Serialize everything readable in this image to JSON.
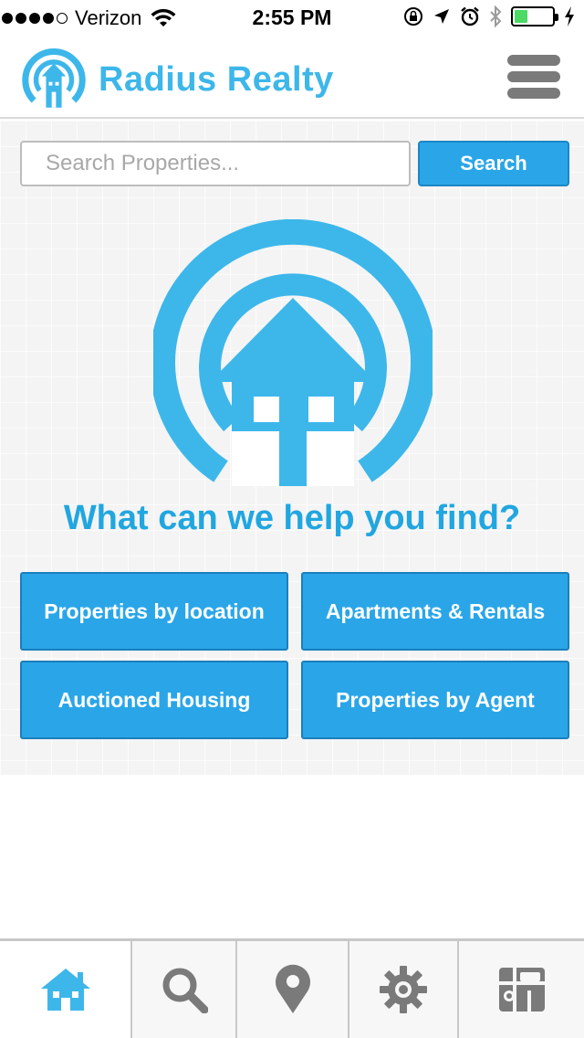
{
  "status_bar": {
    "carrier": "Verizon",
    "time": "2:55 PM",
    "signal_bars_filled": 4,
    "signal_bars_total": 5,
    "battery_level": 0.35,
    "icons": [
      "wifi-icon",
      "rotation-lock-icon",
      "location-arrow-icon",
      "alarm-icon",
      "bluetooth-icon",
      "battery-icon",
      "charging-icon"
    ]
  },
  "header": {
    "brand": "Radius Realty",
    "menu_icon": "hamburger-menu-icon"
  },
  "search": {
    "placeholder": "Search Properties...",
    "value": "",
    "button_label": "Search"
  },
  "hero": {
    "logo_icon": "radius-house-logo-icon",
    "tagline": "What can we help you find?"
  },
  "categories": [
    {
      "label": "Properties by location"
    },
    {
      "label": "Apartments & Rentals"
    },
    {
      "label": "Auctioned Housing"
    },
    {
      "label": "Properties by Agent"
    }
  ],
  "tab_bar": {
    "tabs": [
      {
        "icon": "home-icon",
        "active": true
      },
      {
        "icon": "search-icon",
        "active": false
      },
      {
        "icon": "map-pin-icon",
        "active": false
      },
      {
        "icon": "gear-icon",
        "active": false
      },
      {
        "icon": "map-icon",
        "active": false
      }
    ]
  },
  "colors": {
    "accent": "#2aa6e8",
    "brand": "#3db7ea",
    "tab_icon": "#7a7a7a",
    "tab_active_icon": "#3db7ea"
  }
}
